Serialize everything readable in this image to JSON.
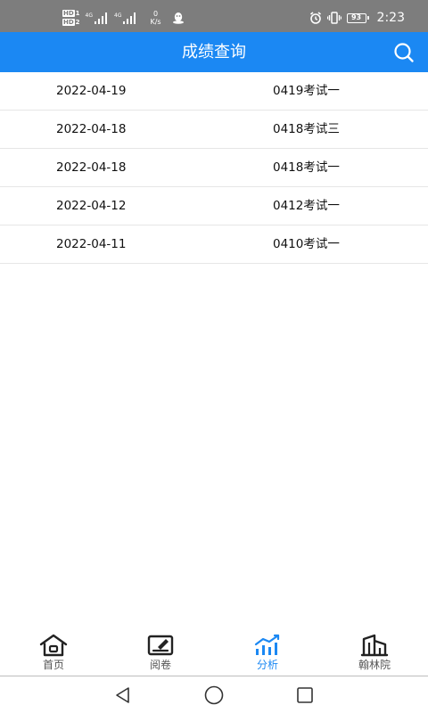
{
  "status_bar": {
    "sim1_badge": "HD",
    "sim1_num": "1",
    "sim2_badge": "HD",
    "sim2_num": "2",
    "sig1_label": "4G",
    "sig2_label": "4G",
    "speed_value": "0",
    "speed_unit": "K/s",
    "battery": "93",
    "time": "2:23"
  },
  "header": {
    "title": "成绩查询"
  },
  "score_list": [
    {
      "date": "2022-04-19",
      "exam": "0419考试一"
    },
    {
      "date": "2022-04-18",
      "exam": "0418考试三"
    },
    {
      "date": "2022-04-18",
      "exam": "0418考试一"
    },
    {
      "date": "2022-04-12",
      "exam": "0412考试一"
    },
    {
      "date": "2022-04-11",
      "exam": "0410考试一"
    }
  ],
  "bottom_nav": [
    {
      "label": "首页",
      "icon": "home-icon"
    },
    {
      "label": "阅卷",
      "icon": "marking-icon"
    },
    {
      "label": "分析",
      "icon": "analysis-chart-icon",
      "active": true
    },
    {
      "label": "翰林院",
      "icon": "building-icon"
    }
  ],
  "colors": {
    "primary": "#1b88f3",
    "status_bar": "#7d7d7d",
    "divider": "#e6e6e6",
    "nav_inactive": "#555555"
  }
}
